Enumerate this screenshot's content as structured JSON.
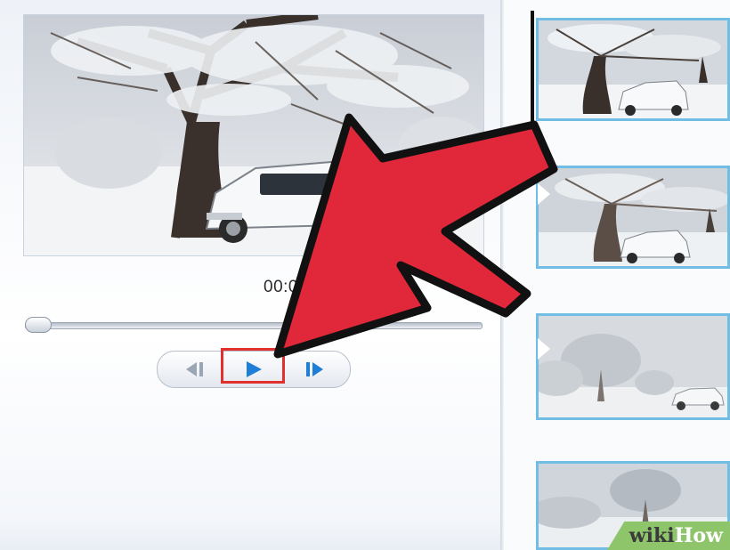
{
  "preview": {
    "time": "00:00",
    "seek_fraction": 0
  },
  "controls": {
    "prev_icon": "previous-frame-icon",
    "play_icon": "play-icon",
    "next_icon": "next-frame-icon",
    "highlight_color": "#e0312f"
  },
  "storyboard": {
    "clips": [
      {
        "icon": "clip-thumbnail-tree-car"
      },
      {
        "icon": "clip-thumbnail-tree-car"
      },
      {
        "icon": "clip-thumbnail-foggy-tree-car"
      },
      {
        "icon": "clip-thumbnail-foggy-tree"
      }
    ],
    "selection_color": "#72bde3"
  },
  "annotation": {
    "arrow_color": "#e0283a"
  },
  "watermark": {
    "part1": "wiki",
    "part2": "How"
  }
}
